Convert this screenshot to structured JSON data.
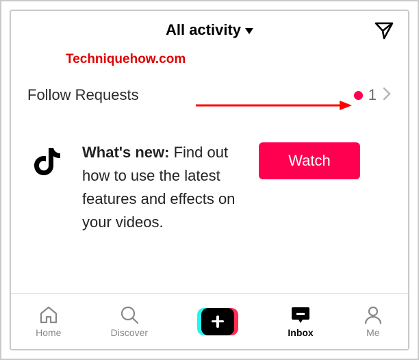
{
  "header": {
    "title": "All activity"
  },
  "watermark": "Techniquehow.com",
  "follow_requests": {
    "label": "Follow Requests",
    "count": "1"
  },
  "promo": {
    "bold": "What's new:",
    "text": " Find out how to use the latest features and effects on your videos.",
    "button": "Watch"
  },
  "tabs": {
    "home": "Home",
    "discover": "Discover",
    "inbox": "Inbox",
    "me": "Me"
  }
}
